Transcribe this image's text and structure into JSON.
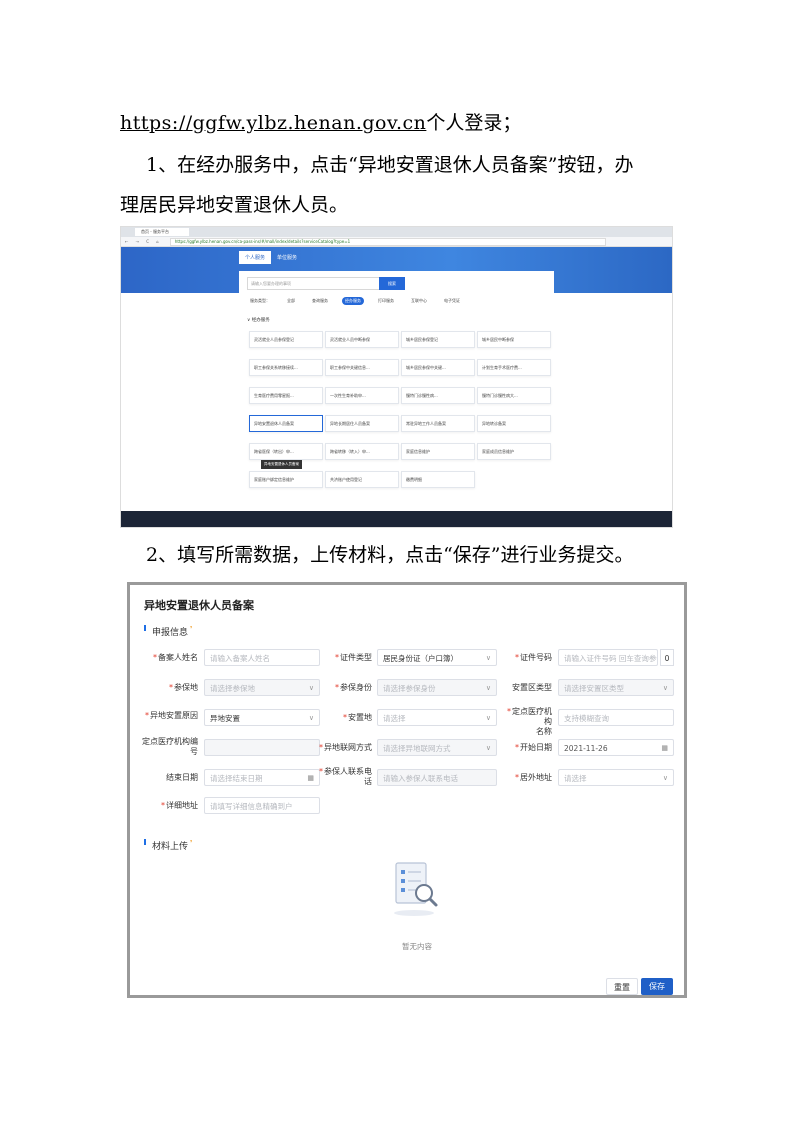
{
  "doc": {
    "line1_url": "https://ggfw.ylbz.henan.gov.cn",
    "line1_rest": "个人登录；",
    "step1_line1": "1、在经办服务中，点击“异地安置退休人员备案”按钮，办",
    "step1_line2": "理居民异地安置退休人员。",
    "step2": "2、填写所需数据，上传材料，点击“保存”进行业务提交。"
  },
  "shot1": {
    "tab_label": "首页 - 服务平台",
    "nav_icons": "← → C ⌂",
    "address": "https://ggfw.ylbz.henan.gov.cn/ca-pass-ins/#/mall/index/details?serviceCatalog?type=1",
    "portal_tabs": [
      "个人服务",
      "单位服务"
    ],
    "search_placeholder": "请输入您要办理的事项",
    "search_button": "搜索",
    "menu": [
      "服务类型：",
      "全部",
      "查询服务",
      "经办服务",
      "打印服务",
      "互联中心",
      "电子凭证"
    ],
    "menu_active_index": 3,
    "section_title": "经办服务",
    "services": [
      "灵活就业人员参保登记",
      "灵活就业人员中断参保",
      "城乡居民参保登记",
      "城乡居民中断参保",
      "职工参保关系转移接续...",
      "职工参保中关键信息...",
      "城乡居民参保中关键...",
      "计划生育手术医疗费...",
      "生育医疗费用零星报...",
      "一次性生育补助申...",
      "慢特门诊慢性病...",
      "慢特门诊慢性病大...",
      "异地安置退休人员备案",
      "异地长期居住人员备案",
      "常驻异地工作人员备案",
      "异地转诊备案",
      "跨省医保（转出）申...",
      "跨省转移（转入）申...",
      "家庭信息维护",
      "家庭成员信息维护",
      "家庭账户绑定信息维护",
      "共济账户使用登记",
      "缴费明细"
    ],
    "tooltip": "异地安置退休人员备案"
  },
  "shot2": {
    "title": "异地安置退休人员备案",
    "section_apply": "申报信息",
    "section_material": "材料上传",
    "fields": {
      "name_label": "备案人姓名",
      "name_ph": "请输入备案人姓名",
      "idtype_label": "证件类型",
      "idtype_val": "居民身份证（户口簿）",
      "idno_label": "证件号码",
      "idno_ph": "请输入证件号码 回车查询参保人",
      "counter": "0",
      "insplace_label": "参保地",
      "insplace_ph": "请选择参保地",
      "insid_label": "参保身份",
      "insid_ph": "请选择参保身份",
      "zone_label": "安置区类型",
      "zone_ph": "请选择安置区类型",
      "reason_label": "异地安置原因",
      "reason_val": "异地安置",
      "place_label": "安置地",
      "place_ph": "请选择",
      "hosp_label1": "定点医疗机构",
      "hosp_label2": "名称",
      "hosp_ph": "支持模糊查询",
      "hospcode_label1": "定点医疗机构编",
      "hospcode_label2": "号",
      "net_label": "异地联网方式",
      "net_ph": "请选择异地联网方式",
      "start_label": "开始日期",
      "start_val": "2021-11-26",
      "end_label": "结束日期",
      "end_ph": "请选择结束日期",
      "phone_label1": "参保人联系电",
      "phone_label2": "话",
      "phone_ph": "请输入参保人联系电话",
      "abroad_label": "居外地址",
      "abroad_ph": "请选择",
      "addr_label": "详细地址",
      "addr_ph": "请填写详细信息精确到户"
    },
    "empty_text": "暂无内容",
    "reset_label": "重置",
    "save_label": "保存"
  }
}
